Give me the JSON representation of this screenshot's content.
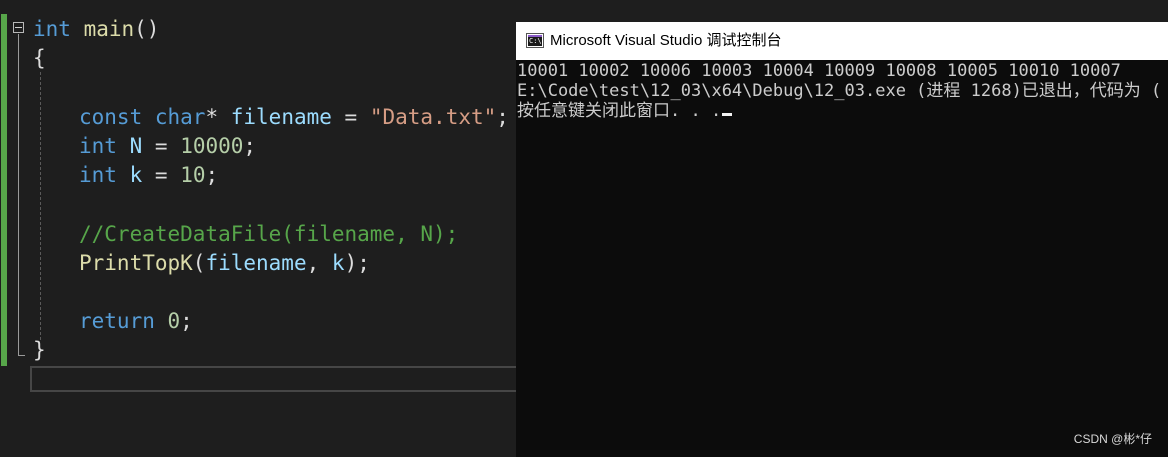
{
  "editor": {
    "lines": [
      {
        "kw": "int",
        "rest": " main",
        "paren": "()"
      },
      {
        "text": "{"
      },
      {
        "kw": "const",
        "kw2": "char",
        "star": "* ",
        "var": "filename",
        "eq": " = ",
        "str": "\"Data.txt\"",
        "end": ";"
      },
      {
        "kw": "int",
        "var": "N",
        "eq": " = ",
        "num": "10000",
        "end": ";"
      },
      {
        "kw": "int",
        "var": "k",
        "eq": " = ",
        "num": "10",
        "end": ";"
      },
      {
        "comment": "//CreateDataFile(filename, N);"
      },
      {
        "fn": "PrintTopK",
        "open": "(",
        "arg1": "filename",
        "comma": ", ",
        "arg2": "k",
        "close": ");"
      },
      {
        "kw": "return",
        "num": "0",
        "end": ";"
      },
      {
        "text": "}"
      }
    ]
  },
  "console": {
    "title": "Microsoft Visual Studio 调试控制台",
    "icon_text": "C:\\",
    "output": [
      "10001 10002 10006 10003 10004 10009 10008 10005 10010 10007",
      "E:\\Code\\test\\12_03\\x64\\Debug\\12_03.exe (进程 1268)已退出，代码为 (",
      "按任意键关闭此窗口. . ."
    ]
  },
  "watermark": "CSDN @彬*仔"
}
